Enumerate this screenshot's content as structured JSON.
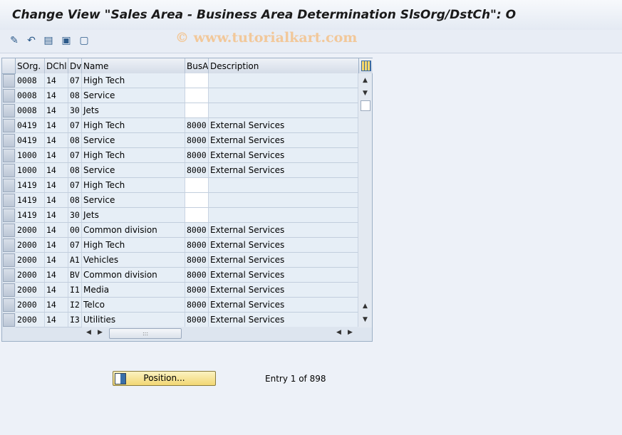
{
  "title": "Change View \"Sales Area - Business Area Determination SlsOrg/DstCh\": O",
  "watermark": "© www.tutorialkart.com",
  "toolbar": {
    "icons": [
      "display-change-icon",
      "undo-icon",
      "select-all-icon",
      "select-block-icon",
      "deselect-all-icon"
    ]
  },
  "table": {
    "columns": [
      "SOrg.",
      "DChl",
      "Dv",
      "Name",
      "BusA",
      "Description"
    ],
    "rows": [
      {
        "sorg": "0008",
        "dchl": "14",
        "dv": "07",
        "name": "High Tech",
        "busa": "",
        "desc": ""
      },
      {
        "sorg": "0008",
        "dchl": "14",
        "dv": "08",
        "name": "Service",
        "busa": "",
        "desc": ""
      },
      {
        "sorg": "0008",
        "dchl": "14",
        "dv": "30",
        "name": "Jets",
        "busa": "",
        "desc": ""
      },
      {
        "sorg": "0419",
        "dchl": "14",
        "dv": "07",
        "name": "High Tech",
        "busa": "8000",
        "desc": "External Services"
      },
      {
        "sorg": "0419",
        "dchl": "14",
        "dv": "08",
        "name": "Service",
        "busa": "8000",
        "desc": "External Services"
      },
      {
        "sorg": "1000",
        "dchl": "14",
        "dv": "07",
        "name": "High Tech",
        "busa": "8000",
        "desc": "External Services"
      },
      {
        "sorg": "1000",
        "dchl": "14",
        "dv": "08",
        "name": "Service",
        "busa": "8000",
        "desc": "External Services"
      },
      {
        "sorg": "1419",
        "dchl": "14",
        "dv": "07",
        "name": "High Tech",
        "busa": "",
        "desc": ""
      },
      {
        "sorg": "1419",
        "dchl": "14",
        "dv": "08",
        "name": "Service",
        "busa": "",
        "desc": ""
      },
      {
        "sorg": "1419",
        "dchl": "14",
        "dv": "30",
        "name": "Jets",
        "busa": "",
        "desc": ""
      },
      {
        "sorg": "2000",
        "dchl": "14",
        "dv": "00",
        "name": "Common division",
        "busa": "8000",
        "desc": "External Services"
      },
      {
        "sorg": "2000",
        "dchl": "14",
        "dv": "07",
        "name": "High Tech",
        "busa": "8000",
        "desc": "External Services"
      },
      {
        "sorg": "2000",
        "dchl": "14",
        "dv": "A1",
        "name": "Vehicles",
        "busa": "8000",
        "desc": "External Services"
      },
      {
        "sorg": "2000",
        "dchl": "14",
        "dv": "BV",
        "name": "Common division",
        "busa": "8000",
        "desc": "External Services"
      },
      {
        "sorg": "2000",
        "dchl": "14",
        "dv": "I1",
        "name": "Media",
        "busa": "8000",
        "desc": "External Services"
      },
      {
        "sorg": "2000",
        "dchl": "14",
        "dv": "I2",
        "name": "Telco",
        "busa": "8000",
        "desc": "External Services"
      },
      {
        "sorg": "2000",
        "dchl": "14",
        "dv": "I3",
        "name": "Utilities",
        "busa": "8000",
        "desc": "External Services"
      }
    ]
  },
  "position_button": {
    "label": "Position..."
  },
  "entry_text": "Entry 1 of 898"
}
